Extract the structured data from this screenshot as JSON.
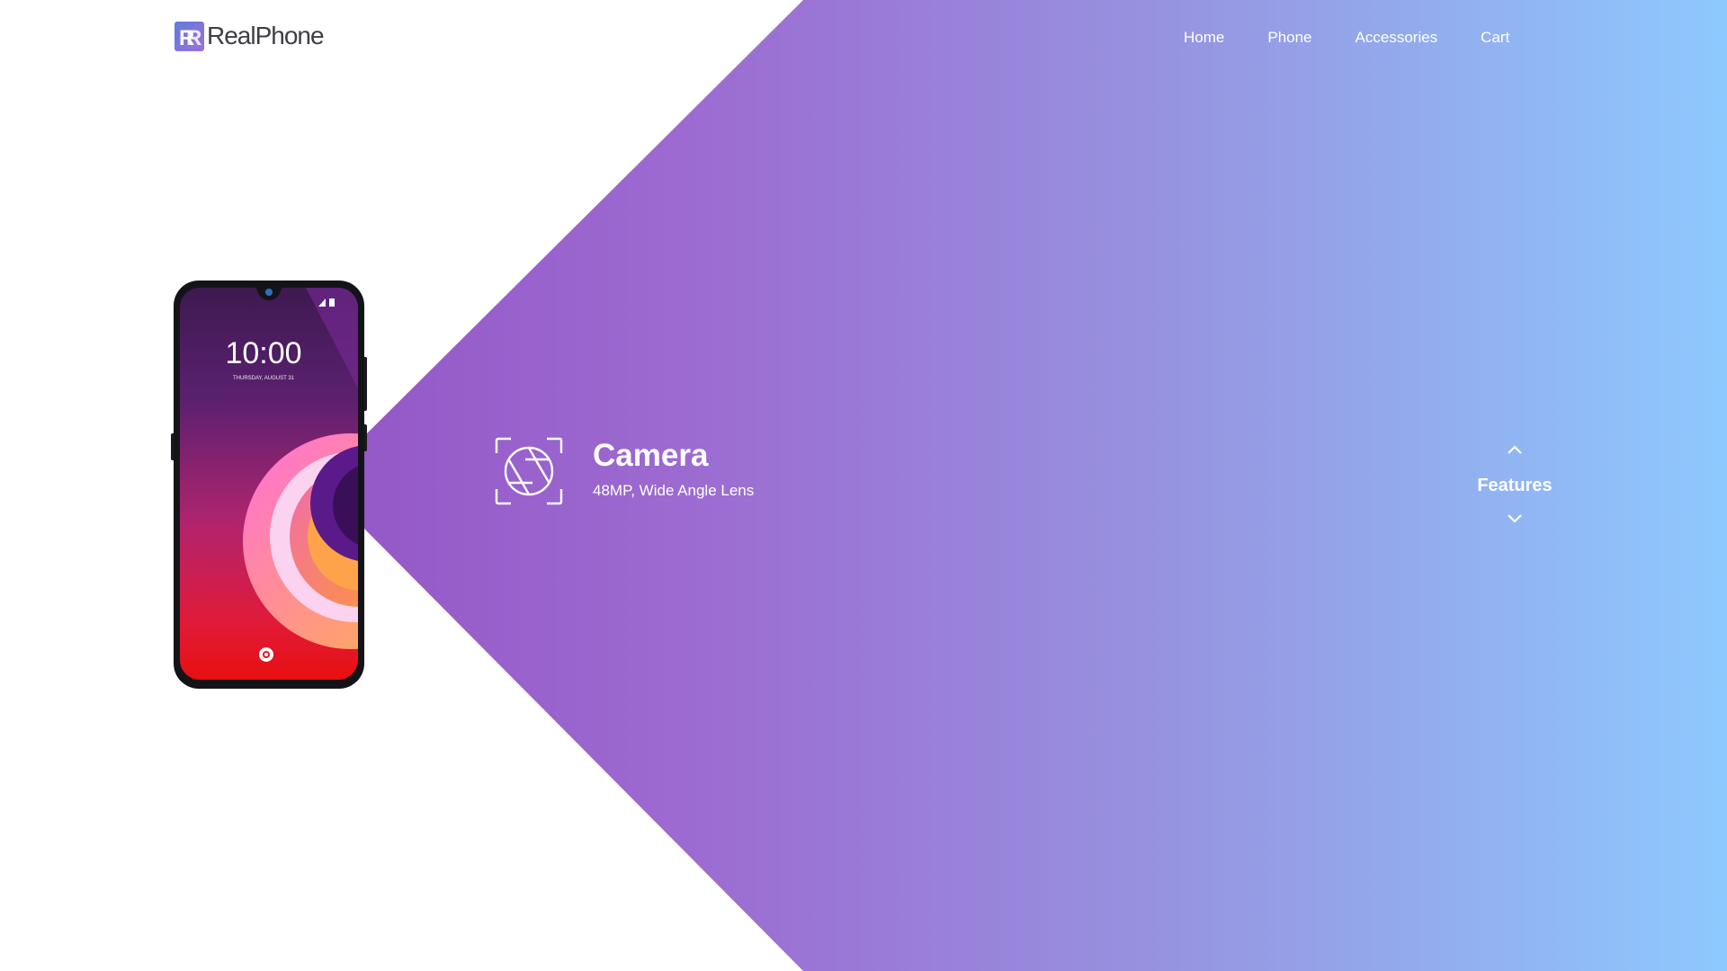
{
  "brand": {
    "logo_text": "RealPhone",
    "logo_icon": "rp-monogram-icon"
  },
  "nav": {
    "items": [
      {
        "label": "Home"
      },
      {
        "label": "Phone"
      },
      {
        "label": "Accessories"
      },
      {
        "label": "Cart"
      }
    ]
  },
  "phone": {
    "lock_time": "10:00",
    "lock_date": "THURSDAY, AUGUST 31"
  },
  "feature": {
    "icon": "camera-aperture-icon",
    "title": "Camera",
    "subtitle": "48MP, Wide Angle Lens"
  },
  "selector": {
    "label": "Features",
    "up_icon": "chevron-up-icon",
    "down_icon": "chevron-down-icon"
  },
  "colors": {
    "gradient_start": "#8e44bd",
    "gradient_end": "#8ec9fe",
    "text_light": "#ffffff",
    "logo_text": "#3e3e44"
  }
}
